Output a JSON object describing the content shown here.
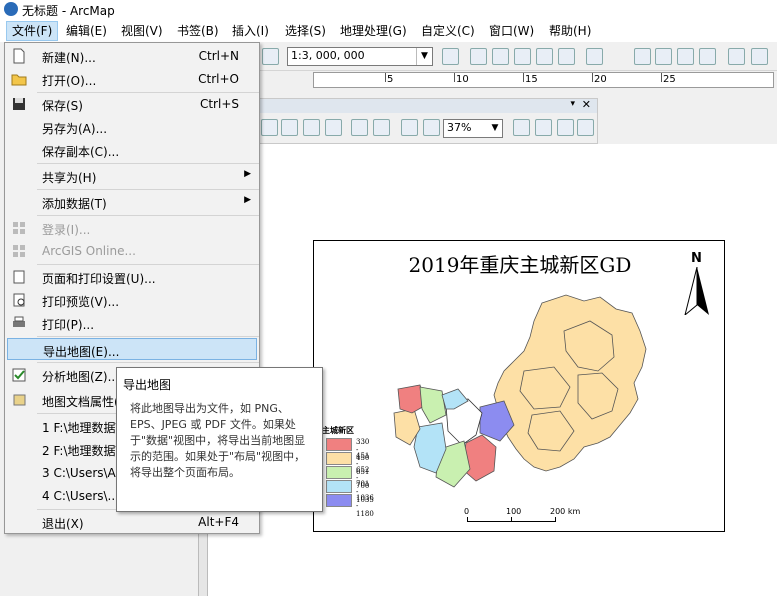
{
  "window": {
    "title": "无标题 - ArcMap"
  },
  "menubar": {
    "items": [
      {
        "label": "文件(F)"
      },
      {
        "label": "编辑(E)"
      },
      {
        "label": "视图(V)"
      },
      {
        "label": "书签(B)"
      },
      {
        "label": "插入(I)"
      },
      {
        "label": "选择(S)"
      },
      {
        "label": "地理处理(G)"
      },
      {
        "label": "自定义(C)"
      },
      {
        "label": "窗口(W)"
      },
      {
        "label": "帮助(H)"
      }
    ]
  },
  "toolbar": {
    "scale_value": "1:3, 000, 000",
    "zoom_value": "37%"
  },
  "ruler": {
    "labels": [
      "5",
      "10",
      "15",
      "20",
      "25"
    ]
  },
  "file_menu": {
    "items": [
      {
        "label": "新建(N)...",
        "shortcut": "Ctrl+N",
        "icon": "new-doc-icon"
      },
      {
        "label": "打开(O)...",
        "shortcut": "Ctrl+O",
        "icon": "open-folder-icon"
      },
      {
        "label": "保存(S)",
        "shortcut": "Ctrl+S",
        "icon": "save-icon"
      },
      {
        "label": "另存为(A)...",
        "shortcut": ""
      },
      {
        "label": "保存副本(C)...",
        "shortcut": ""
      },
      {
        "label": "共享为(H)",
        "shortcut": "",
        "submenu": true
      },
      {
        "label": "添加数据(T)",
        "shortcut": "",
        "submenu": true
      },
      {
        "label": "登录(I)...",
        "shortcut": "",
        "disabled": true
      },
      {
        "label": "ArcGIS Online...",
        "shortcut": "",
        "disabled": true
      },
      {
        "label": "页面和打印设置(U)...",
        "shortcut": ""
      },
      {
        "label": "打印预览(V)...",
        "shortcut": ""
      },
      {
        "label": "打印(P)...",
        "shortcut": ""
      },
      {
        "label": "导出地图(E)...",
        "shortcut": "",
        "hover": true
      },
      {
        "label": "分析地图(Z)...",
        "shortcut": ""
      },
      {
        "label": "地图文档属性(",
        "shortcut": ""
      },
      {
        "label": "1 F:\\地理数据\\",
        "shortcut": ""
      },
      {
        "label": "2 F:\\地理数据\\",
        "shortcut": ""
      },
      {
        "label": "3 C:\\Users\\Ac",
        "shortcut": ""
      },
      {
        "label": "4 C:\\Users\\...\\",
        "shortcut": ""
      },
      {
        "label": "退出(X)",
        "shortcut": "Alt+F4"
      }
    ]
  },
  "tooltip": {
    "title": "导出地图",
    "body": "将此地图导出为文件，如 PNG、EPS、JPEG 或 PDF 文件。如果处于\"数据\"视图中，将导出当前地图显示的范围。如果处于\"布局\"视图中，将导出整个页面布局。"
  },
  "map": {
    "title": "2019年重庆主城新区GD",
    "north_label": "N",
    "legend_title": "主城新区",
    "legend": [
      {
        "label": "330 - 450",
        "color": "#f08080"
      },
      {
        "label": "451 - 651",
        "color": "#fde0a6"
      },
      {
        "label": "652 - 700",
        "color": "#c9f0b0"
      },
      {
        "label": "701 - 1035",
        "color": "#b3e3f7"
      },
      {
        "label": "1036 - 1180",
        "color": "#8c8cf0"
      }
    ],
    "scalebar": {
      "labels": [
        "0",
        "100",
        "200 km"
      ]
    }
  }
}
